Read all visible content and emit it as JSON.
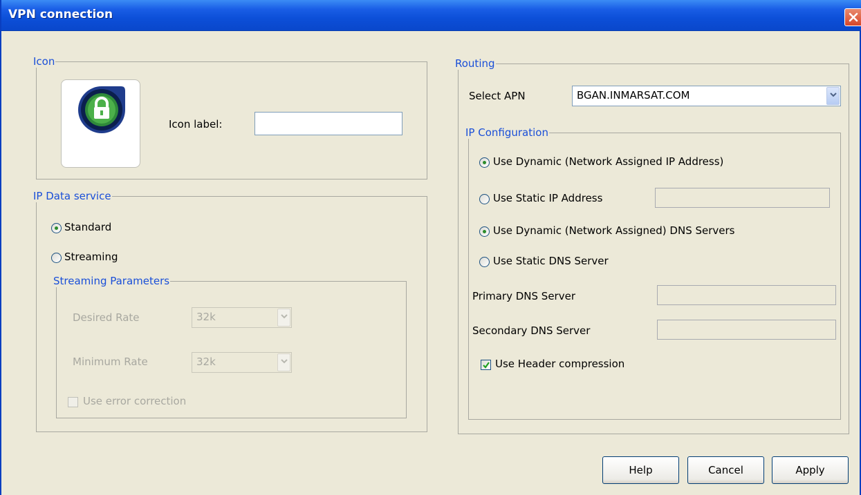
{
  "window": {
    "title": "VPN connection"
  },
  "icon_group": {
    "legend": "Icon",
    "icon_label": "Icon label:",
    "icon_label_value": ""
  },
  "ip_service": {
    "legend": "IP Data service",
    "standard": "Standard",
    "streaming": "Streaming",
    "selected": "Standard",
    "params": {
      "legend": "Streaming Parameters",
      "desired_rate_label": "Desired Rate",
      "desired_rate_value": "32k",
      "minimum_rate_label": "Minimum Rate",
      "minimum_rate_value": "32k",
      "error_correction": "Use error correction",
      "error_correction_checked": false
    }
  },
  "routing": {
    "legend": "Routing",
    "select_apn_label": "Select APN",
    "select_apn_value": "BGAN.INMARSAT.COM",
    "ip_config": {
      "legend": "IP Configuration",
      "dynamic_ip": "Use Dynamic (Network Assigned IP Address)",
      "static_ip": "Use Static IP Address",
      "dynamic_dns": "Use Dynamic (Network Assigned) DNS Servers",
      "static_dns": "Use Static DNS Server",
      "primary_dns_label": "Primary DNS Server",
      "secondary_dns_label": "Secondary DNS Server",
      "header_compression": "Use Header compression",
      "header_compression_checked": true
    }
  },
  "buttons": {
    "help": "Help",
    "cancel": "Cancel",
    "apply": "Apply"
  },
  "colors": {
    "titlebar": "#0c4fd8",
    "legend_text": "#1a4fd8",
    "background": "#ece9d8"
  }
}
